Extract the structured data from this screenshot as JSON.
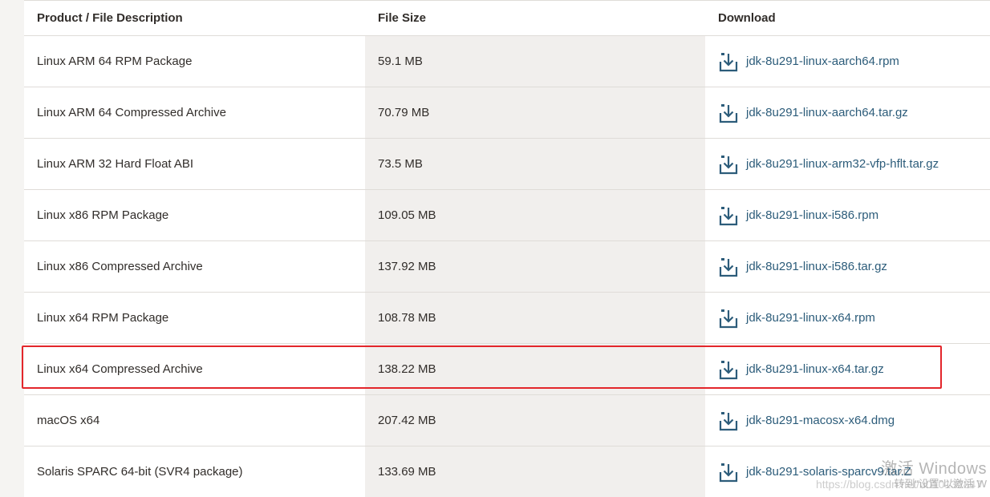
{
  "table": {
    "headers": {
      "description": "Product / File Description",
      "size": "File Size",
      "download": "Download"
    },
    "rows": [
      {
        "description": "Linux ARM 64 RPM Package",
        "size": "59.1 MB",
        "file": "jdk-8u291-linux-aarch64.rpm"
      },
      {
        "description": "Linux ARM 64 Compressed Archive",
        "size": "70.79 MB",
        "file": "jdk-8u291-linux-aarch64.tar.gz"
      },
      {
        "description": "Linux ARM 32 Hard Float ABI",
        "size": "73.5 MB",
        "file": "jdk-8u291-linux-arm32-vfp-hflt.tar.gz"
      },
      {
        "description": "Linux x86 RPM Package",
        "size": "109.05 MB",
        "file": "jdk-8u291-linux-i586.rpm"
      },
      {
        "description": "Linux x86 Compressed Archive",
        "size": "137.92 MB",
        "file": "jdk-8u291-linux-i586.tar.gz"
      },
      {
        "description": "Linux x64 RPM Package",
        "size": "108.78 MB",
        "file": "jdk-8u291-linux-x64.rpm"
      },
      {
        "description": "Linux x64 Compressed Archive",
        "size": "138.22 MB",
        "file": "jdk-8u291-linux-x64.tar.gz"
      },
      {
        "description": "macOS x64",
        "size": "207.42 MB",
        "file": "jdk-8u291-macosx-x64.dmg"
      },
      {
        "description": "Solaris SPARC 64-bit (SVR4 package)",
        "size": "133.69 MB",
        "file": "jdk-8u291-solaris-sparcv9.tar.Z"
      }
    ]
  },
  "watermark": {
    "title": "激活 Windows",
    "subtitle": "转到“设置”以激活 W",
    "url": "https://blog.csdn.net/u010132847"
  },
  "colors": {
    "link": "#2c5c7a",
    "highlight": "#e3262b",
    "size_column_bg": "#f1efed"
  },
  "icons": {
    "download": "download-arrow-tray-icon"
  }
}
